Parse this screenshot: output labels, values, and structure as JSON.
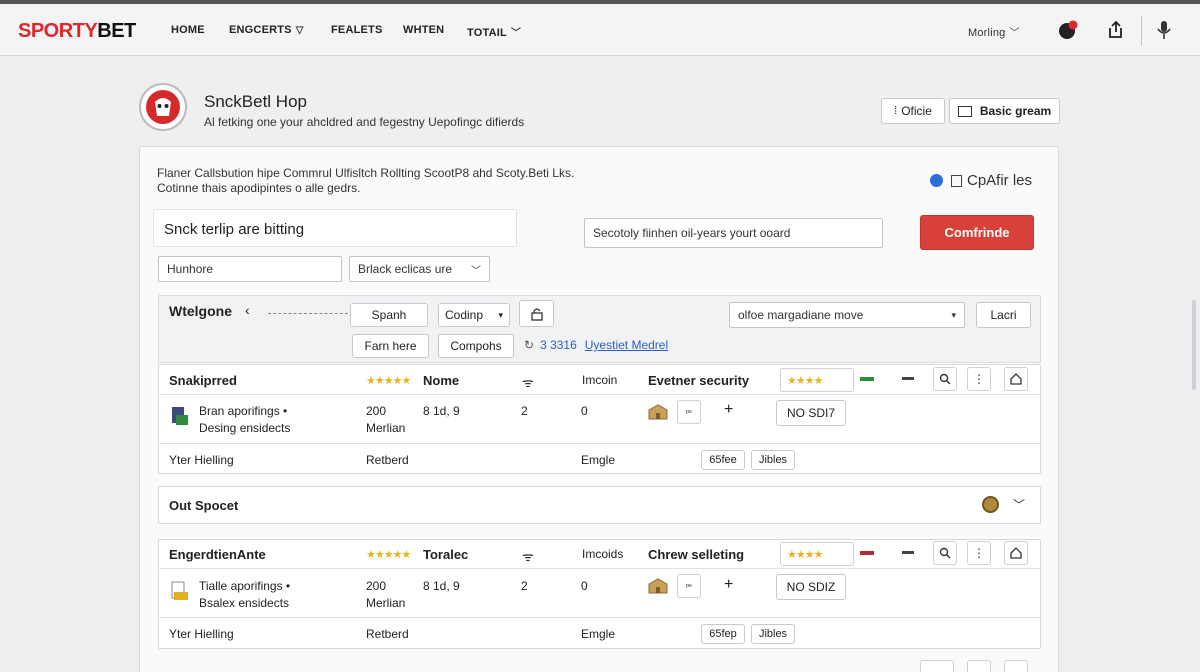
{
  "header": {
    "brand_red": "SPORTY",
    "brand_black": "BET",
    "nav": [
      "HOME",
      "ENGCERTS",
      "FEALETS",
      "WHTEN",
      "TOTAIL"
    ],
    "user_menu": "Morling"
  },
  "profile": {
    "title": "SnckBetl Hop",
    "subtitle": "Al fetking one your ahcldred and fegestny Uepofingc difierds",
    "btn_office": "Oficie",
    "btn_basic": "Basic gream"
  },
  "info": {
    "line1": "Flaner Callsbution hipe Commrul Ulfisltch Rollting ScootP8 ahd Scoty.Beti Lks.",
    "line2": "Cotinne thais apodipintes o alle gedrs.",
    "link": "CpAfir les"
  },
  "form": {
    "heading": "Snck terlip are bitting",
    "search_placeholder": "Secotoly fiinhen oil-years yourt ooard",
    "confirm": "Comfrinde",
    "input1": "Hunhore",
    "select1": "Brlack eclicas ure"
  },
  "filter": {
    "label": "Wtelgone",
    "chip_search": "Spanh",
    "chip_compare": "Codinp",
    "chip_farm": "Farn here",
    "chip_compo": "Compohs",
    "count": "3 3316",
    "count_link": "Uyestiet Medrel",
    "select": "olfoe margadiane move",
    "load": "Lacri"
  },
  "events": [
    {
      "name": "Snakiprred",
      "stars": "★★★★★",
      "col_name": "Nome",
      "col_info": "Imcoin",
      "security": "Evetner security",
      "stars2": "★★★★",
      "status_color": "#2e8b3a",
      "line1": "Bran aporifings •",
      "line2": "Desing ensidects",
      "v1": "200",
      "v1b": "Merlian",
      "v2": "8  1d, 9",
      "v3": "2",
      "v4": "0",
      "tag": "NO SDI7",
      "f1": "Yter Hielling",
      "f2": "Retberd",
      "f3": "Emgle",
      "f4": "65fee",
      "f5": "Jibles"
    },
    {
      "name": "EngerdtienAnte",
      "stars": "★★★★★",
      "col_name": "Toralec",
      "col_info": "Imcoids",
      "security": "Chrew selleting",
      "stars2": "★★★★",
      "status_color": "#b03030",
      "line1": "Tialle aporifings •",
      "line2": "Bsalex ensidects",
      "v1": "200",
      "v1b": "Merlian",
      "v2": "8  1d, 9",
      "v3": "2",
      "v4": "0",
      "tag": "NO SDIZ",
      "f1": "Yter Hielling",
      "f2": "Retberd",
      "f3": "Emgle",
      "f4": "65fep",
      "f5": "Jibles"
    }
  ],
  "spocet": {
    "label": "Out Spocet"
  },
  "icons": {
    "chevron": "▾",
    "plus": "+",
    "minus": "−",
    "wifi": "ᯤ"
  }
}
